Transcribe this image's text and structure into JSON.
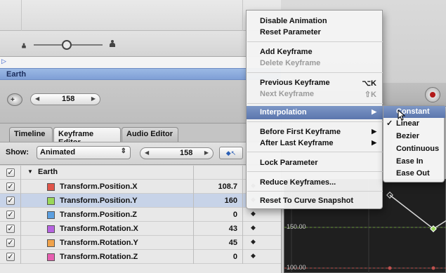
{
  "track": {
    "name": "Earth"
  },
  "frame": {
    "current": "158"
  },
  "tabs": [
    {
      "label": "Timeline"
    },
    {
      "label": "Keyframe Editor"
    },
    {
      "label": "Audio Editor"
    }
  ],
  "show": {
    "label": "Show:",
    "selected": "Animated",
    "frame": "158"
  },
  "group": {
    "name": "Earth"
  },
  "params": [
    {
      "name": "Transform.Position.X",
      "value": "108.7",
      "color": "#e0554a"
    },
    {
      "name": "Transform.Position.Y",
      "value": "160",
      "color": "#9ad85a"
    },
    {
      "name": "Transform.Position.Z",
      "value": "0",
      "color": "#5b9fe0"
    },
    {
      "name": "Transform.Rotation.X",
      "value": "43",
      "color": "#b763e0"
    },
    {
      "name": "Transform.Rotation.Y",
      "value": "45",
      "color": "#f0a24a"
    },
    {
      "name": "Transform.Rotation.Z",
      "value": "0",
      "color": "#e65fb0"
    }
  ],
  "graph": {
    "label_mid": "150.00",
    "label_low": "100.00"
  },
  "menu": {
    "disable_animation": "Disable Animation",
    "reset_parameter": "Reset Parameter",
    "add_keyframe": "Add Keyframe",
    "delete_keyframe": "Delete Keyframe",
    "previous_keyframe": "Previous Keyframe",
    "previous_shortcut": "⌥K",
    "next_keyframe": "Next Keyframe",
    "next_shortcut": "⇧K",
    "interpolation": "Interpolation",
    "before_first": "Before First Keyframe",
    "after_last": "After Last Keyframe",
    "lock_parameter": "Lock Parameter",
    "reduce_keyframes": "Reduce Keyframes...",
    "reset_curve": "Reset To Curve Snapshot"
  },
  "submenu": {
    "items": [
      "Constant",
      "Linear",
      "Bezier",
      "Continuous",
      "Ease In",
      "Ease Out"
    ],
    "checked": "Linear",
    "highlighted": "Constant"
  }
}
